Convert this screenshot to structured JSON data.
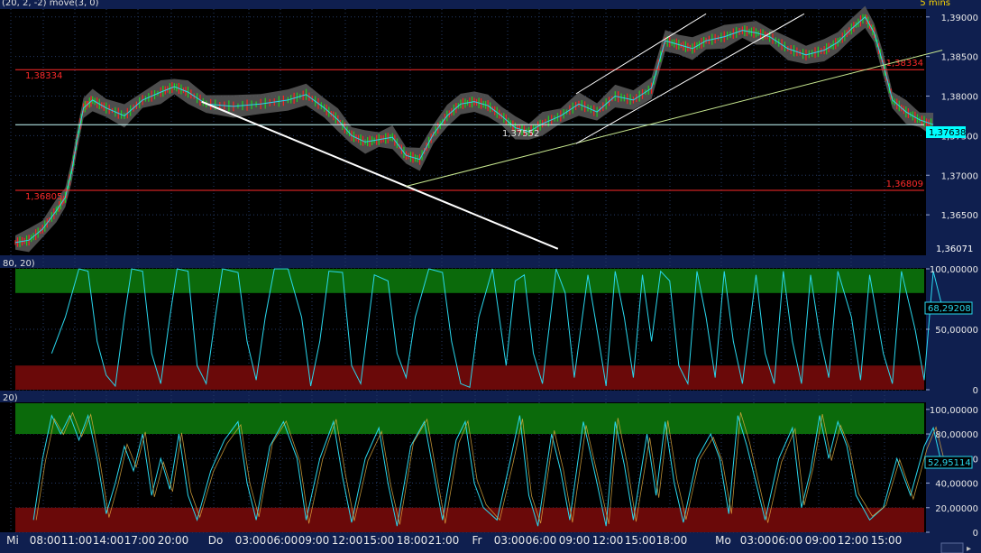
{
  "header": {
    "indicator_fragment": "(20, 2, -2) move(3, 0)",
    "timeframe": "5 mins"
  },
  "price_panel": {
    "current_price_label": "1,37638",
    "bottom_right_label": "1,36071",
    "levels": [
      {
        "name": "level-upper",
        "value": 1.38334,
        "label": "1,38334",
        "left_label": "1,38334"
      },
      {
        "name": "level-lower",
        "value": 1.36809,
        "label": "1,36809",
        "left_label": "1,36805"
      },
      {
        "name": "level-mid",
        "value": 1.37638,
        "label": "",
        "left_label": ""
      }
    ],
    "mid_annotation": "1,37552"
  },
  "osc1": {
    "label": "80, 20)",
    "current_label": "68,29208"
  },
  "osc2": {
    "label": "20)",
    "current_label": "52,95114"
  },
  "colors": {
    "background": "#000000",
    "grid": "#243a66",
    "axis_bg": "#0f1f4f",
    "band": "#5a5a5a",
    "level": "#ff2a2a",
    "current_price_bg": "#00ffff",
    "osc_line": "#29d8ee",
    "zone_high": "#0b6a0b",
    "zone_low": "#6a0909",
    "candle_up": "#1dd11d",
    "candle_down": "#ff2222"
  },
  "chart_data": [
    {
      "type": "line",
      "title": "",
      "ylim": [
        1.36,
        1.391
      ],
      "y_ticks": [
        1.365,
        1.37,
        1.375,
        1.38,
        1.385,
        1.39
      ],
      "y_tick_labels": [
        "1,36500",
        "1,37000",
        "1,37500",
        "1,38000",
        "1,38500",
        "1,39000"
      ],
      "x_tick_labels": [
        "Mi",
        "08:00",
        "11:00",
        "14:00",
        "17:00",
        "20:00",
        "Do",
        "03:00",
        "06:00",
        "09:00",
        "12:00",
        "15:00",
        "18:00",
        "21:00",
        "Fr",
        "03:00",
        "06:00",
        "09:00",
        "12:00",
        "15:00",
        "18:00",
        "Mo",
        "03:00",
        "06:00",
        "09:00",
        "12:00",
        "15:00"
      ],
      "x_range": [
        0,
        1000
      ],
      "series": [
        {
          "values_xy": [
            [
              0,
              1.3615
            ],
            [
              15,
              1.3618
            ],
            [
              30,
              1.3632
            ],
            [
              45,
              1.3655
            ],
            [
              55,
              1.3672
            ],
            [
              62,
              1.3705
            ],
            [
              68,
              1.3745
            ],
            [
              75,
              1.3785
            ],
            [
              85,
              1.3795
            ],
            [
              100,
              1.3785
            ],
            [
              120,
              1.3775
            ],
            [
              140,
              1.3795
            ],
            [
              160,
              1.3805
            ],
            [
              175,
              1.3812
            ],
            [
              190,
              1.3805
            ],
            [
              210,
              1.379
            ],
            [
              240,
              1.3787
            ],
            [
              270,
              1.379
            ],
            [
              300,
              1.3795
            ],
            [
              320,
              1.3802
            ],
            [
              340,
              1.3785
            ],
            [
              355,
              1.377
            ],
            [
              370,
              1.375
            ],
            [
              385,
              1.3742
            ],
            [
              400,
              1.3745
            ],
            [
              415,
              1.3748
            ],
            [
              430,
              1.3725
            ],
            [
              445,
              1.372
            ],
            [
              460,
              1.3752
            ],
            [
              475,
              1.3775
            ],
            [
              490,
              1.379
            ],
            [
              505,
              1.3793
            ],
            [
              520,
              1.3788
            ],
            [
              535,
              1.3775
            ],
            [
              550,
              1.376
            ],
            [
              565,
              1.3755
            ],
            [
              580,
              1.3765
            ],
            [
              600,
              1.3775
            ],
            [
              620,
              1.379
            ],
            [
              640,
              1.378
            ],
            [
              660,
              1.38
            ],
            [
              680,
              1.3795
            ],
            [
              700,
              1.381
            ],
            [
              715,
              1.387
            ],
            [
              730,
              1.3865
            ],
            [
              745,
              1.386
            ],
            [
              760,
              1.387
            ],
            [
              780,
              1.3875
            ],
            [
              800,
              1.3883
            ],
            [
              815,
              1.388
            ],
            [
              830,
              1.3875
            ],
            [
              850,
              1.386
            ],
            [
              870,
              1.3852
            ],
            [
              890,
              1.3858
            ],
            [
              905,
              1.3868
            ],
            [
              920,
              1.3885
            ],
            [
              935,
              1.39
            ],
            [
              945,
              1.388
            ],
            [
              955,
              1.384
            ],
            [
              965,
              1.3795
            ],
            [
              980,
              1.378
            ],
            [
              995,
              1.377
            ],
            [
              1010,
              1.3764
            ]
          ]
        }
      ],
      "trendlines": [
        {
          "name": "descending-line",
          "color": "#ffffff",
          "from": [
            205,
            1.3793
          ],
          "to": [
            597,
            1.3607
          ]
        },
        {
          "name": "support-line",
          "color": "#c8e890",
          "from": [
            430,
            1.3686
          ],
          "to": [
            1020,
            1.3858
          ]
        },
        {
          "name": "channel-upper",
          "color": "#ffffff",
          "from": [
            617,
            1.3803
          ],
          "to": [
            760,
            1.3904
          ]
        },
        {
          "name": "channel-lower",
          "color": "#ffffff",
          "from": [
            617,
            1.374
          ],
          "to": [
            868,
            1.3904
          ]
        }
      ]
    },
    {
      "type": "line",
      "title": "",
      "ylim": [
        0,
        100
      ],
      "y_ticks": [
        0,
        50,
        100
      ],
      "y_tick_labels": [
        "0",
        "50,00000",
        "100,00000"
      ],
      "zones": {
        "high": [
          80,
          100
        ],
        "low": [
          0,
          20
        ]
      },
      "series": [
        {
          "values_xy": [
            [
              40,
              30
            ],
            [
              55,
              60
            ],
            [
              70,
              100
            ],
            [
              80,
              98
            ],
            [
              90,
              40
            ],
            [
              100,
              12
            ],
            [
              110,
              3
            ],
            [
              120,
              60
            ],
            [
              128,
              100
            ],
            [
              140,
              98
            ],
            [
              150,
              30
            ],
            [
              160,
              5
            ],
            [
              170,
              60
            ],
            [
              178,
              100
            ],
            [
              190,
              98
            ],
            [
              200,
              20
            ],
            [
              210,
              5
            ],
            [
              220,
              60
            ],
            [
              228,
              100
            ],
            [
              245,
              97
            ],
            [
              255,
              40
            ],
            [
              265,
              8
            ],
            [
              275,
              60
            ],
            [
              285,
              100
            ],
            [
              300,
              100
            ],
            [
              315,
              60
            ],
            [
              325,
              3
            ],
            [
              335,
              40
            ],
            [
              345,
              98
            ],
            [
              360,
              97
            ],
            [
              370,
              20
            ],
            [
              380,
              5
            ],
            [
              395,
              95
            ],
            [
              410,
              90
            ],
            [
              420,
              30
            ],
            [
              430,
              10
            ],
            [
              440,
              60
            ],
            [
              455,
              100
            ],
            [
              470,
              97
            ],
            [
              480,
              40
            ],
            [
              490,
              5
            ],
            [
              500,
              2
            ],
            [
              510,
              60
            ],
            [
              525,
              100
            ],
            [
              540,
              20
            ],
            [
              550,
              90
            ],
            [
              560,
              95
            ],
            [
              570,
              30
            ],
            [
              580,
              5
            ],
            [
              595,
              100
            ],
            [
              605,
              80
            ],
            [
              615,
              10
            ],
            [
              630,
              95
            ],
            [
              640,
              50
            ],
            [
              650,
              3
            ],
            [
              660,
              98
            ],
            [
              670,
              60
            ],
            [
              680,
              10
            ],
            [
              690,
              95
            ],
            [
              700,
              40
            ],
            [
              710,
              98
            ],
            [
              720,
              90
            ],
            [
              730,
              20
            ],
            [
              740,
              5
            ],
            [
              750,
              98
            ],
            [
              760,
              60
            ],
            [
              770,
              10
            ],
            [
              780,
              98
            ],
            [
              790,
              40
            ],
            [
              800,
              5
            ],
            [
              815,
              95
            ],
            [
              825,
              30
            ],
            [
              835,
              5
            ],
            [
              845,
              98
            ],
            [
              855,
              40
            ],
            [
              865,
              5
            ],
            [
              875,
              95
            ],
            [
              885,
              45
            ],
            [
              895,
              10
            ],
            [
              905,
              98
            ],
            [
              920,
              60
            ],
            [
              930,
              8
            ],
            [
              940,
              95
            ],
            [
              955,
              30
            ],
            [
              965,
              5
            ],
            [
              975,
              98
            ],
            [
              990,
              50
            ],
            [
              1000,
              8
            ],
            [
              1010,
              98
            ],
            [
              1020,
              68
            ]
          ]
        }
      ]
    },
    {
      "type": "line",
      "title": "",
      "ylim": [
        0,
        105
      ],
      "y_ticks": [
        0,
        20,
        40,
        60,
        80,
        100
      ],
      "y_tick_labels": [
        "0",
        "20,00000",
        "40,00000",
        "60,00000",
        "80,00000",
        "100,00000"
      ],
      "zones": {
        "high": [
          80,
          105
        ],
        "low": [
          0,
          20
        ]
      },
      "series": [
        {
          "values_xy": [
            [
              20,
              10
            ],
            [
              30,
              60
            ],
            [
              40,
              95
            ],
            [
              50,
              80
            ],
            [
              60,
              95
            ],
            [
              70,
              75
            ],
            [
              80,
              95
            ],
            [
              90,
              60
            ],
            [
              100,
              15
            ],
            [
              110,
              40
            ],
            [
              120,
              70
            ],
            [
              130,
              50
            ],
            [
              140,
              80
            ],
            [
              150,
              30
            ],
            [
              160,
              60
            ],
            [
              170,
              35
            ],
            [
              180,
              80
            ],
            [
              190,
              30
            ],
            [
              200,
              10
            ],
            [
              215,
              50
            ],
            [
              230,
              75
            ],
            [
              245,
              90
            ],
            [
              255,
              40
            ],
            [
              265,
              10
            ],
            [
              280,
              70
            ],
            [
              295,
              90
            ],
            [
              310,
              60
            ],
            [
              320,
              10
            ],
            [
              335,
              60
            ],
            [
              350,
              90
            ],
            [
              360,
              45
            ],
            [
              370,
              8
            ],
            [
              385,
              60
            ],
            [
              400,
              85
            ],
            [
              410,
              40
            ],
            [
              420,
              5
            ],
            [
              435,
              70
            ],
            [
              450,
              90
            ],
            [
              460,
              50
            ],
            [
              470,
              10
            ],
            [
              485,
              75
            ],
            [
              495,
              90
            ],
            [
              505,
              40
            ],
            [
              515,
              20
            ],
            [
              530,
              10
            ],
            [
              545,
              60
            ],
            [
              555,
              95
            ],
            [
              565,
              30
            ],
            [
              575,
              5
            ],
            [
              590,
              80
            ],
            [
              600,
              50
            ],
            [
              610,
              10
            ],
            [
              625,
              90
            ],
            [
              640,
              40
            ],
            [
              650,
              5
            ],
            [
              660,
              90
            ],
            [
              670,
              55
            ],
            [
              680,
              10
            ],
            [
              695,
              80
            ],
            [
              705,
              30
            ],
            [
              715,
              90
            ],
            [
              725,
              40
            ],
            [
              735,
              8
            ],
            [
              750,
              60
            ],
            [
              765,
              80
            ],
            [
              775,
              60
            ],
            [
              785,
              15
            ],
            [
              795,
              95
            ],
            [
              805,
              70
            ],
            [
              815,
              40
            ],
            [
              825,
              10
            ],
            [
              840,
              60
            ],
            [
              855,
              85
            ],
            [
              865,
              20
            ],
            [
              875,
              50
            ],
            [
              885,
              95
            ],
            [
              895,
              60
            ],
            [
              905,
              90
            ],
            [
              915,
              70
            ],
            [
              925,
              30
            ],
            [
              940,
              10
            ],
            [
              955,
              20
            ],
            [
              970,
              60
            ],
            [
              985,
              30
            ],
            [
              1000,
              70
            ],
            [
              1010,
              85
            ],
            [
              1020,
              53
            ]
          ]
        }
      ]
    }
  ]
}
